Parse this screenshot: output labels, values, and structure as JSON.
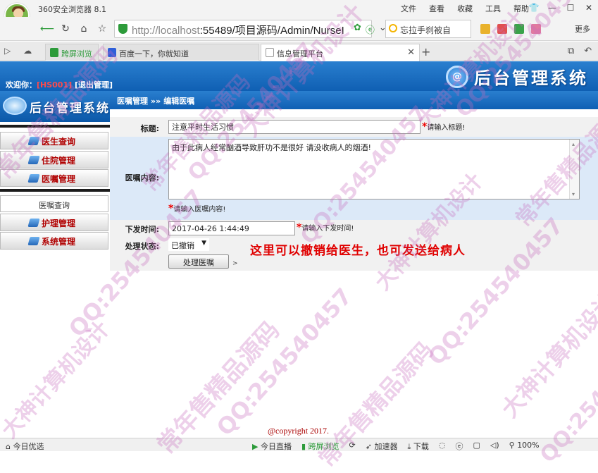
{
  "browser": {
    "title": "360安全浏览器 8.1",
    "menu": [
      "文件",
      "查看",
      "收藏",
      "工具",
      "帮助"
    ],
    "url_host": "http://localhost",
    "url_rest": ":55489/项目源码/Admin/NurseI",
    "search_text": "忘拉手刹被自",
    "more_label": "更多",
    "tabs": [
      {
        "label": "跨屏浏览"
      },
      {
        "label": "百度一下，你就知道"
      },
      {
        "label": "信息管理平台"
      }
    ],
    "status_left": "今日优选",
    "status_items": [
      "今日直播",
      "跨屏浏览",
      "",
      "加速器",
      "下载",
      "",
      "",
      "",
      "",
      "100%"
    ]
  },
  "header": {
    "welcome_prefix": "欢迎你：",
    "user_id": "[HS001]",
    "logout": "[退出管理]",
    "system_title": "后台管理系统"
  },
  "sidebar": {
    "logo_title": "后台管理系统",
    "items": [
      {
        "label": "医生查询"
      },
      {
        "label": "住院管理"
      },
      {
        "label": "医嘱管理"
      }
    ],
    "plain_item": "医嘱查询",
    "items2": [
      {
        "label": "护理管理"
      },
      {
        "label": "系统管理"
      }
    ]
  },
  "breadcrumb": {
    "section": "医嘱管理",
    "separator": "»»",
    "page": "编辑医嘱"
  },
  "form": {
    "title_label": "标题:",
    "title_value": "注意平时生活习惯",
    "title_hint": "请输入标题!",
    "content_label": "医嘱内容:",
    "content_value": "由于此病人经常酗酒导致肝功不是很好 请没收病人的烟酒!",
    "content_hint": "请输入医嘱内容!",
    "time_label": "下发时间:",
    "time_value": "2017-04-26 1:44:49",
    "time_hint": "请输入下发时间!",
    "status_label": "处理状态:",
    "status_value": "已撤销",
    "submit_label": "处理医嘱",
    "note": "这里可以撤销给医生，也可发送给病人"
  },
  "footer": {
    "copyright": "@copyright 2017."
  },
  "watermark": {
    "qq": "QQ:254540457",
    "a": "常年售精品源码",
    "b": "大神计算机设计"
  },
  "colors": {
    "header_blue": "#1a6fc4",
    "sidebar_red": "#b00000",
    "note_red": "#e00000",
    "watermark": "#c86ebe"
  }
}
